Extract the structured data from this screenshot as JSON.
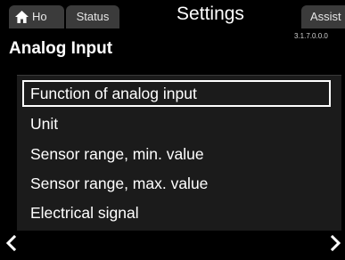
{
  "tabs": {
    "home_label": "Ho",
    "status_label": "Status",
    "active_label": "Settings",
    "assist_label": "Assist"
  },
  "version": "3.1.7.0.0.0",
  "page_title": "Analog Input",
  "menu": {
    "items": [
      {
        "label": "Function of analog input",
        "selected": true
      },
      {
        "label": "Unit"
      },
      {
        "label": "Sensor range, min. value"
      },
      {
        "label": "Sensor range, max. value"
      },
      {
        "label": "Electrical signal"
      }
    ]
  },
  "icons": {
    "home": "home-icon",
    "back": "chevron-left-icon",
    "forward": "chevron-right-icon"
  },
  "colors": {
    "background": "#000000",
    "tab_inactive": "#3b3b3b",
    "panel": "#1b1b1b",
    "text": "#ffffff"
  }
}
